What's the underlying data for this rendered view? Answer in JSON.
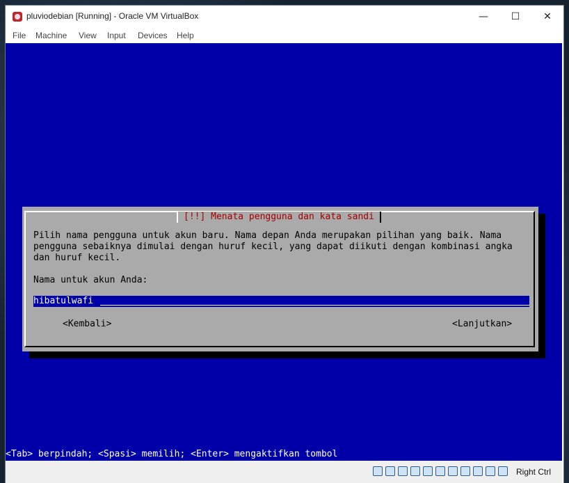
{
  "window": {
    "title": "pluviodebian [Running] - Oracle VM VirtualBox",
    "minimize_glyph": "—",
    "maximize_glyph": "☐",
    "close_glyph": "✕"
  },
  "menu": {
    "file": "File",
    "machine": "Machine",
    "view": "View",
    "input": "Input",
    "devices": "Devices",
    "help": "Help"
  },
  "installer": {
    "title": "[!!] Menata pengguna dan kata sandi",
    "description": "Pilih nama pengguna untuk akun baru. Nama depan Anda merupakan pilihan yang baik. Nama\npengguna sebaiknya dimulai dengan huruf kecil, yang dapat diikuti dengan kombinasi angka\ndan huruf kecil.",
    "field_label": "Nama untuk akun Anda:",
    "field_value": "hibatulwafi",
    "back_button": "<Kembali>",
    "continue_button": "<Lanjutkan>",
    "hint": "<Tab> berpindah; <Spasi> memilih; <Enter> mengaktifkan tombol"
  },
  "statusbar": {
    "icons": [
      "hard-disk-icon",
      "optical-drive-icon",
      "audio-icon",
      "network-icon",
      "usb-icon",
      "shared-folders-icon",
      "display-icon",
      "video-capture-icon",
      "cpu-icon",
      "mouse-integration-icon",
      "keyboard-icon"
    ],
    "host_key": "Right Ctrl"
  },
  "colors": {
    "vm_background": "#0000a8",
    "dialog_background": "#aaaaaa",
    "dialog_title": "#a80000"
  }
}
